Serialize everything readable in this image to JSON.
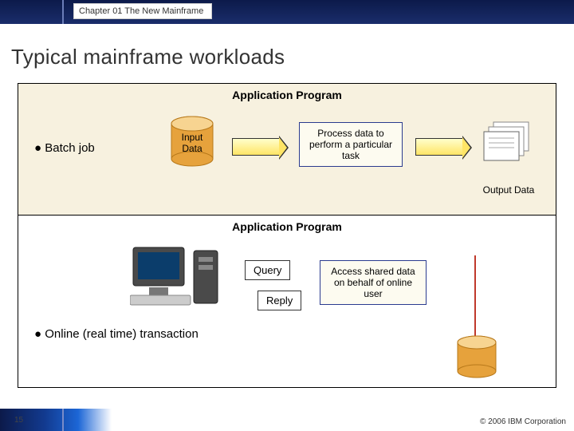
{
  "header": {
    "chapter": "Chapter 01 The New Mainframe"
  },
  "title": "Typical mainframe workloads",
  "pane1": {
    "app_title": "Application Program",
    "bullet": "Batch job",
    "input_label": "Input\nData",
    "process_text": "Process data to perform a particular task",
    "output_label": "Output Data"
  },
  "pane2": {
    "app_title": "Application Program",
    "query_label": "Query",
    "reply_label": "Reply",
    "bullet": "Online (real time) transaction",
    "process_text": "Access shared data on behalf of online user"
  },
  "footer": {
    "page": "15",
    "copyright": "© 2006 IBM Corporation"
  },
  "colors": {
    "brand_navy": "#0c1a4a",
    "panel_tan": "#f7f1df",
    "cylinder": "#e6a23c"
  }
}
